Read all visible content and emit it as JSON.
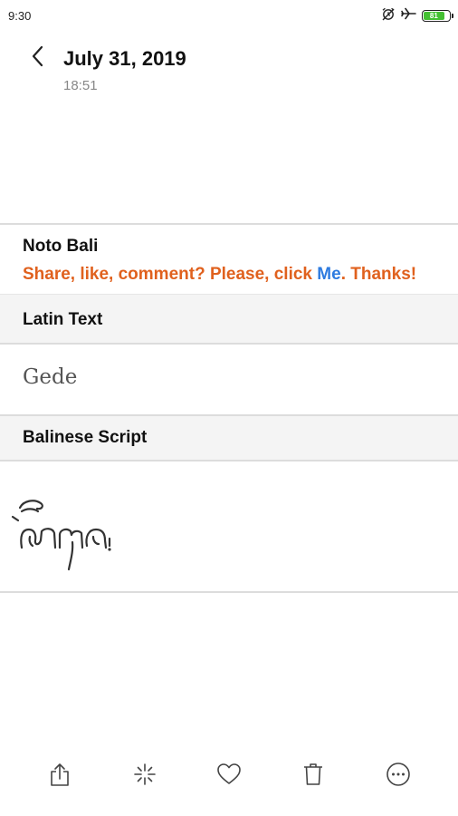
{
  "status_bar": {
    "time": "9:30",
    "battery_level": "81",
    "battery_fraction": 0.81,
    "battery_color": "#44c032",
    "icons": [
      "alarm-off-icon",
      "airplane-icon",
      "battery-icon"
    ]
  },
  "header": {
    "title": "July 31, 2019",
    "time": "18:51",
    "back_icon": "chevron-left-icon"
  },
  "note": {
    "title": "Noto Bali",
    "promo": {
      "prefix": "Share, like, comment? Please, click ",
      "link": "Me",
      "suffix": ". Thanks!",
      "text_color": "#e0611e",
      "link_color": "#2d7be0"
    },
    "latin_label": "Latin Text",
    "latin_value": "Gede",
    "script_label": "Balinese Script",
    "script_image": "balinese-script-gede"
  },
  "toolbar": {
    "items": [
      {
        "icon": "share-icon"
      },
      {
        "icon": "sparkle-icon"
      },
      {
        "icon": "heart-icon"
      },
      {
        "icon": "trash-icon"
      },
      {
        "icon": "more-icon"
      }
    ]
  }
}
